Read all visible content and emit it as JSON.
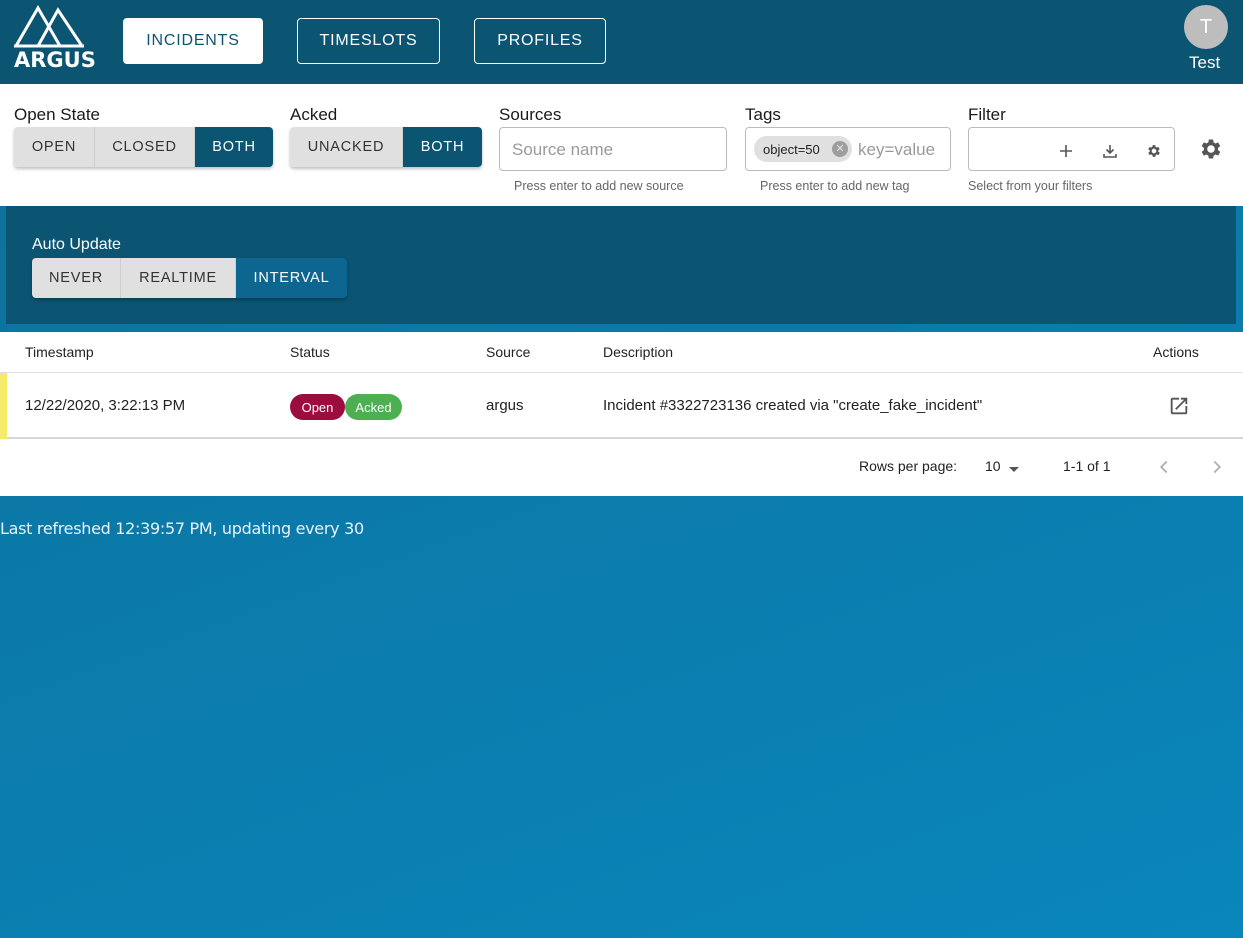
{
  "header": {
    "logo_text": "ARGUS",
    "nav": [
      {
        "label": "INCIDENTS",
        "active": true
      },
      {
        "label": "TIMESLOTS",
        "active": false
      },
      {
        "label": "PROFILES",
        "active": false
      }
    ],
    "user_initial": "T",
    "user_name": "Test"
  },
  "filters": {
    "open_state": {
      "label": "Open State",
      "options": [
        "OPEN",
        "CLOSED",
        "BOTH"
      ],
      "selected": "BOTH"
    },
    "acked": {
      "label": "Acked",
      "options": [
        "UNACKED",
        "BOTH"
      ],
      "selected": "BOTH"
    },
    "sources": {
      "label": "Sources",
      "placeholder": "Source name",
      "helper": "Press enter to add new source"
    },
    "tags": {
      "label": "Tags",
      "chip": "object=50",
      "placeholder": "key=value",
      "helper": "Press enter to add new tag"
    },
    "filter": {
      "label": "Filter",
      "helper": "Select from your filters"
    }
  },
  "auto_update": {
    "label": "Auto Update",
    "options": [
      "NEVER",
      "REALTIME",
      "INTERVAL"
    ],
    "selected": "INTERVAL"
  },
  "table": {
    "columns": [
      "Timestamp",
      "Status",
      "Source",
      "Description",
      "Actions"
    ],
    "rows": [
      {
        "timestamp": "12/22/2020, 3:22:13 PM",
        "status": [
          "Open",
          "Acked"
        ],
        "source": "argus",
        "description": "Incident #3322723136 created via \"create_fake_incident\""
      }
    ],
    "rows_per_page_label": "Rows per page:",
    "rows_per_page": "10",
    "range": "1-1 of 1"
  },
  "footer": {
    "refresh_text": "Last refreshed 12:39:57 PM, updating every 30"
  },
  "colors": {
    "primary": "#0b5573",
    "open_badge": "#9b0d3f",
    "acked_badge": "#4caf50",
    "row_indicator": "#f5ea6a"
  }
}
